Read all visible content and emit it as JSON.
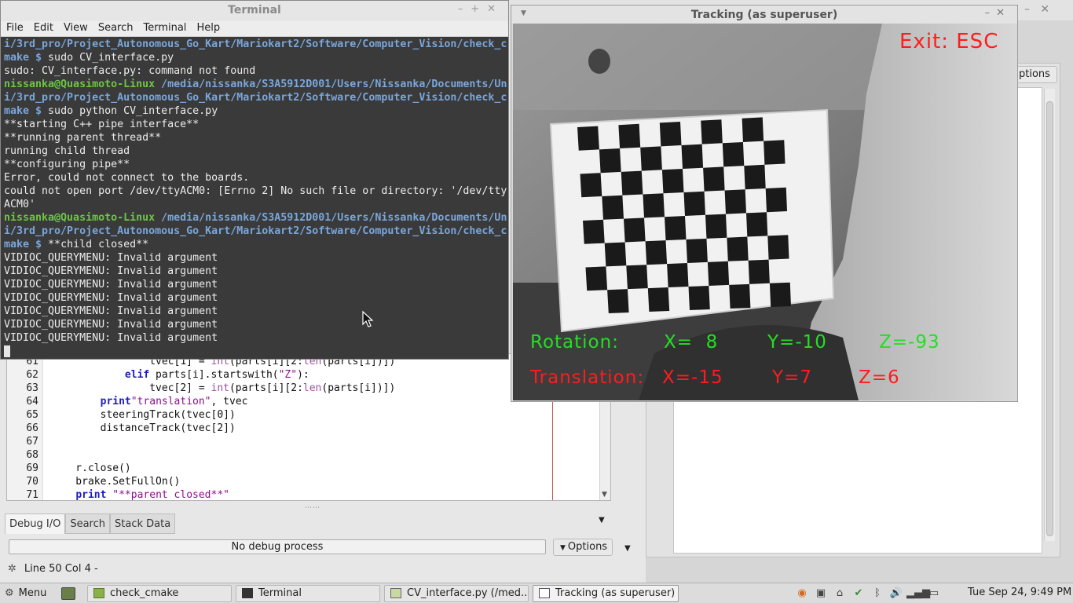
{
  "terminal": {
    "title": "Terminal",
    "menu": [
      "File",
      "Edit",
      "View",
      "Search",
      "Terminal",
      "Help"
    ],
    "lines": [
      {
        "text": "i/3rd_pro/Project_Autonomous_Go_Kart/Mariokart2/Software/Computer_Vision/check_c",
        "style": "blue"
      },
      {
        "prefix": "make $",
        "text": " sudo CV_interface.py",
        "style": "mixed"
      },
      {
        "text": "sudo: CV_interface.py: command not found",
        "style": "plain"
      },
      {
        "prefix": "nissanka@Quasimoto-Linux",
        "text": " /media/nissanka/S3A5912D001/Users/Nissanka/Documents/Un",
        "style": "prompt"
      },
      {
        "text": "i/3rd_pro/Project_Autonomous_Go_Kart/Mariokart2/Software/Computer_Vision/check_c",
        "style": "blue"
      },
      {
        "prefix": "make $",
        "text": " sudo python CV_interface.py",
        "style": "mixed"
      },
      {
        "text": "**starting C++ pipe interface**",
        "style": "plain"
      },
      {
        "text": "**running parent thread**",
        "style": "plain"
      },
      {
        "text": "running child thread",
        "style": "plain"
      },
      {
        "text": "**configuring pipe**",
        "style": "plain"
      },
      {
        "text": "Error, could not connect to the boards.",
        "style": "plain"
      },
      {
        "text": "could not open port /dev/ttyACM0: [Errno 2] No such file or directory: '/dev/tty",
        "style": "plain"
      },
      {
        "text": "ACM0'",
        "style": "plain"
      },
      {
        "prefix": "nissanka@Quasimoto-Linux",
        "text": " /media/nissanka/S3A5912D001/Users/Nissanka/Documents/Un",
        "style": "prompt"
      },
      {
        "text": "i/3rd_pro/Project_Autonomous_Go_Kart/Mariokart2/Software/Computer_Vision/check_c",
        "style": "blue"
      },
      {
        "prefix": "make $",
        "text": " **child closed**",
        "style": "mixed"
      },
      {
        "text": "VIDIOC_QUERYMENU: Invalid argument",
        "style": "plain"
      },
      {
        "text": "VIDIOC_QUERYMENU: Invalid argument",
        "style": "plain"
      },
      {
        "text": "VIDIOC_QUERYMENU: Invalid argument",
        "style": "plain"
      },
      {
        "text": "VIDIOC_QUERYMENU: Invalid argument",
        "style": "plain"
      },
      {
        "text": "VIDIOC_QUERYMENU: Invalid argument",
        "style": "plain"
      },
      {
        "text": "VIDIOC_QUERYMENU: Invalid argument",
        "style": "plain"
      },
      {
        "text": "VIDIOC_QUERYMENU: Invalid argument",
        "style": "plain"
      }
    ]
  },
  "editor": {
    "lines": [
      {
        "n": "61",
        "html": "                tvec[1] = <span class=\"bi\">int</span>(parts[i][2:<span class=\"bi\">len</span>(parts[i])])"
      },
      {
        "n": "62",
        "html": "            <span class=\"kw\">elif</span> parts[i].startswith(<span class=\"str\">\"Z\"</span>):"
      },
      {
        "n": "63",
        "html": "                tvec[2] = <span class=\"bi\">int</span>(parts[i][2:<span class=\"bi\">len</span>(parts[i])])"
      },
      {
        "n": "64",
        "html": "        <span class=\"kw\">print</span><span class=\"str\">\"translation\"</span>, tvec"
      },
      {
        "n": "65",
        "html": "        steeringTrack(tvec[0])"
      },
      {
        "n": "66",
        "html": "        distanceTrack(tvec[2])"
      },
      {
        "n": "67",
        "html": ""
      },
      {
        "n": "68",
        "html": ""
      },
      {
        "n": "69",
        "html": "    r.close()"
      },
      {
        "n": "70",
        "html": "    brake.SetFullOn()"
      },
      {
        "n": "71",
        "html": "    <span class=\"kw\">print</span> <span class=\"str\">\"**parent closed**\"</span>"
      }
    ]
  },
  "debug": {
    "tabs": [
      "Debug I/O",
      "Search",
      "Stack Data"
    ],
    "status": "No debug process",
    "options_label": "Options"
  },
  "statusline": "Line 50 Col 4 -",
  "right_panel": {
    "options_label": "ptions"
  },
  "tracking": {
    "title": "Tracking (as superuser)",
    "exit_label": "Exit: ESC",
    "rotation": {
      "label": "Rotation:",
      "x": "X=  8",
      "y": "Y=-10",
      "z": "Z=-93"
    },
    "translation": {
      "label": "Translation:",
      "x": "X=-15",
      "y": "Y=7",
      "z": "Z=6"
    }
  },
  "taskbar": {
    "menu_label": "Menu",
    "items": [
      {
        "label": "check_cmake",
        "icon": "folder-icon"
      },
      {
        "label": "Terminal",
        "icon": "terminal-icon"
      },
      {
        "label": "CV_interface.py (/med...",
        "icon": "editor-icon"
      },
      {
        "label": "Tracking (as superuser)",
        "icon": "window-icon"
      }
    ],
    "clock": "Tue Sep 24,  9:49 PM"
  }
}
